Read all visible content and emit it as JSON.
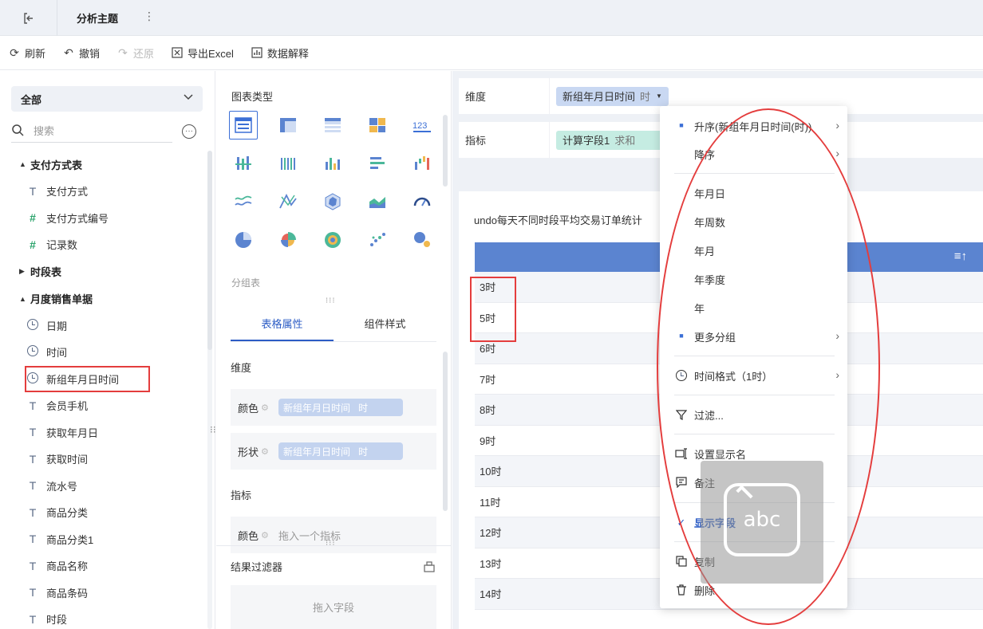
{
  "tabbar": {
    "back_icon": "exit-icon",
    "tab_label": "分析主题",
    "more_icon": "⋮"
  },
  "toolbar": {
    "refresh": "刷新",
    "undo": "撤销",
    "redo": "还原",
    "export": "导出Excel",
    "explain": "数据解释"
  },
  "fields": {
    "scope": "全部",
    "search_placeholder": "搜索",
    "groups": [
      {
        "name": "支付方式表",
        "expanded": true,
        "items": [
          {
            "type": "text",
            "label": "支付方式"
          },
          {
            "type": "number",
            "label": "支付方式编号"
          },
          {
            "type": "number",
            "label": "记录数"
          }
        ]
      },
      {
        "name": "时段表",
        "expanded": false,
        "items": []
      },
      {
        "name": "月度销售单据",
        "expanded": true,
        "items": [
          {
            "type": "date",
            "label": "日期"
          },
          {
            "type": "date",
            "label": "时间"
          },
          {
            "type": "date",
            "label": "新组年月日时间"
          },
          {
            "type": "text",
            "label": "会员手机"
          },
          {
            "type": "text",
            "label": "获取年月日"
          },
          {
            "type": "text",
            "label": "获取时间"
          },
          {
            "type": "text",
            "label": "流水号"
          },
          {
            "type": "text",
            "label": "商品分类"
          },
          {
            "type": "text",
            "label": "商品分类1"
          },
          {
            "type": "text",
            "label": "商品名称"
          },
          {
            "type": "text",
            "label": "商品条码"
          },
          {
            "type": "text",
            "label": "时段"
          }
        ]
      }
    ]
  },
  "config": {
    "chart_type_title": "图表类型",
    "chart_name": "分组表",
    "tabs": [
      "表格属性",
      "组件样式"
    ],
    "dimension_title": "维度",
    "color_label": "颜色",
    "shape_label": "形状",
    "dim_pill": "新组年月日时间",
    "dim_pill_sub": "时",
    "metric_title": "指标",
    "metric_color_label": "颜色",
    "metric_placeholder": "拖入一个指标",
    "filter_title": "结果过滤器",
    "filter_placeholder": "拖入字段"
  },
  "editor": {
    "dimension_label": "维度",
    "dimension_field": "新组年月日时间",
    "dimension_sub": "时",
    "metric_label": "指标",
    "metric_field": "计算字段1",
    "metric_sub": "求和",
    "chart_title": "undo每天不同时段平均交易订单统计",
    "rows": [
      "3时",
      "5时",
      "6时",
      "7时",
      "8时",
      "9时",
      "10时",
      "11时",
      "12时",
      "13时",
      "14时"
    ]
  },
  "menu": {
    "items": [
      {
        "label": "升序(新组年月日时间(时))",
        "mark": "dot",
        "arrow": true
      },
      {
        "label": "降序",
        "mark": "",
        "arrow": true
      },
      {
        "label": "年月日",
        "mark": "",
        "arrow": false
      },
      {
        "label": "年周数",
        "mark": "",
        "arrow": false
      },
      {
        "label": "年月",
        "mark": "",
        "arrow": false
      },
      {
        "label": "年季度",
        "mark": "",
        "arrow": false
      },
      {
        "label": "年",
        "mark": "",
        "arrow": false
      },
      {
        "label": "更多分组",
        "mark": "dot",
        "arrow": true
      },
      {
        "label": "时间格式（1时）",
        "mark": "clock",
        "arrow": true
      },
      {
        "label": "过滤...",
        "mark": "filter",
        "arrow": false
      },
      {
        "label": "设置显示名",
        "mark": "rename",
        "arrow": false
      },
      {
        "label": "备注",
        "mark": "note",
        "arrow": false
      },
      {
        "label": "显示字段",
        "mark": "check",
        "arrow": false
      },
      {
        "label": "复制",
        "mark": "copy",
        "arrow": false
      },
      {
        "label": "删除",
        "mark": "trash",
        "arrow": false
      }
    ]
  },
  "ime_overlay": {
    "text": "abc"
  },
  "colors": {
    "accent": "#2c5cc5",
    "table_header": "#5b84d0",
    "annotation": "#e43d3d"
  }
}
